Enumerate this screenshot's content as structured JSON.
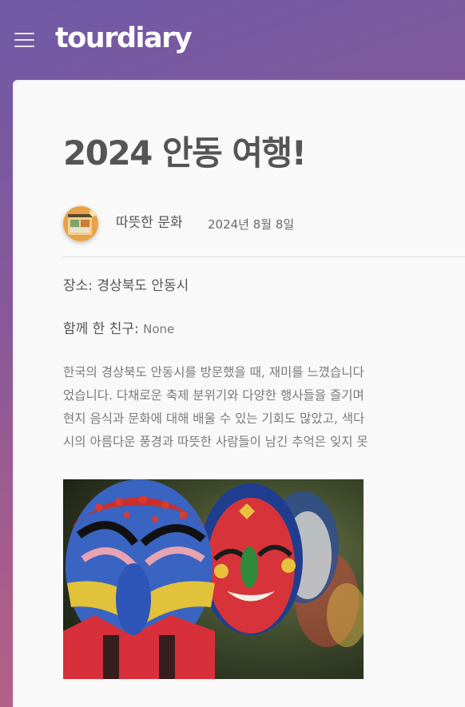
{
  "header": {
    "logo": "tourdiary",
    "menu_icon": "hamburger-menu-icon"
  },
  "post": {
    "title": "2024 안동 여행!",
    "author": "따뜻한 문화",
    "date": "2024년 8월 8일",
    "location_label": "장소:",
    "location_value": "경상북도 안동시",
    "companion_label": "함께 한 친구:",
    "companion_value": "None",
    "body_lines": [
      "한국의 경상북도 안동시를 방문했을 때, 재미를 느꼈습니다",
      "었습니다. 다채로운 축제 분위기와 다양한 행사들을 즐기며",
      "현지 음식과 문화에 대해 배울 수 있는 기회도 많았고, 색다",
      "시의 아름다운 풍경과 따뜻한 사람들이 남긴 추억은 잊지 못"
    ],
    "photo_icon": "traditional-mask-photo"
  },
  "colors": {
    "gradient_top": "#6f5aa6",
    "gradient_bottom": "#c06480",
    "card_background": "#f9f9f9",
    "title_text": "#555555",
    "body_text": "#7a7a7a"
  }
}
